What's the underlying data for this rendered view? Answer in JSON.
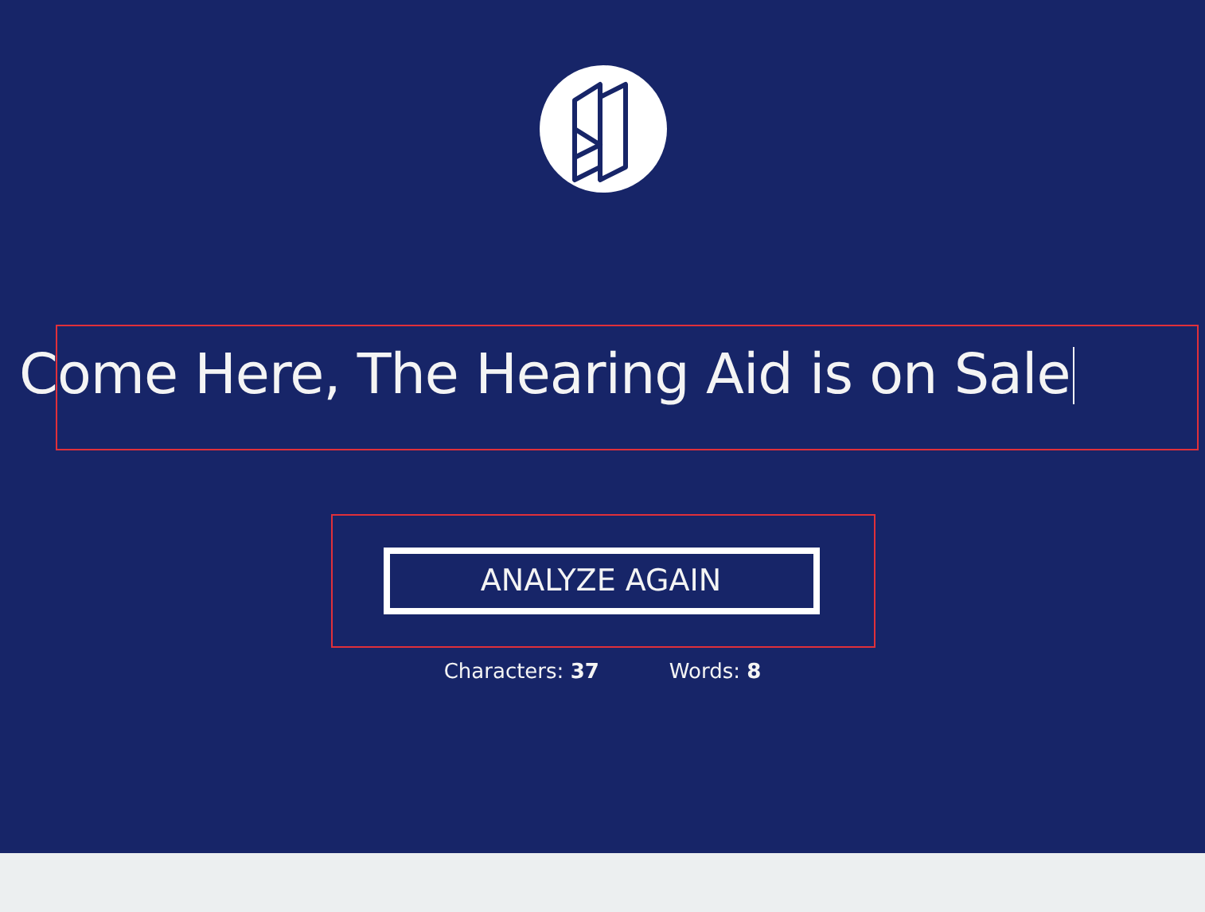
{
  "headline": {
    "value": "Come Here, The Hearing Aid is on Sale"
  },
  "button": {
    "label": "ANALYZE AGAIN"
  },
  "stats": [
    {
      "text": "Characters: **37**"
    },
    {
      "text": "Words: **8**"
    }
  ]
}
